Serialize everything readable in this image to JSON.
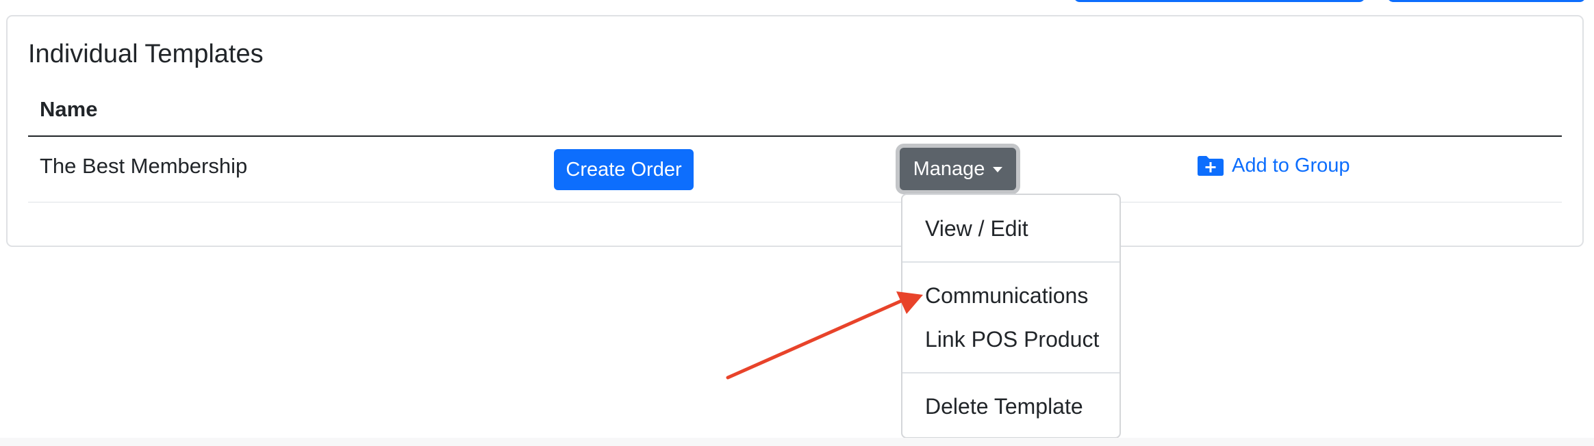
{
  "card": {
    "title": "Individual Templates",
    "table": {
      "columns": [
        "Name"
      ],
      "rows": [
        {
          "name": "The Best Membership",
          "create_order_label": "Create Order",
          "manage_label": "Manage",
          "add_to_group_label": "Add to Group"
        }
      ]
    }
  },
  "manage_menu": {
    "items": [
      "View / Edit",
      "Communications",
      "Link POS Product",
      "Delete Template"
    ]
  },
  "colors": {
    "primary": "#0d6efd",
    "secondary": "#5c636a",
    "annotation_arrow": "#e8432a"
  },
  "icons": {
    "add_to_group": "folder-plus-icon",
    "manage_caret": "caret-down-icon",
    "annotation": "arrow-annotation"
  }
}
